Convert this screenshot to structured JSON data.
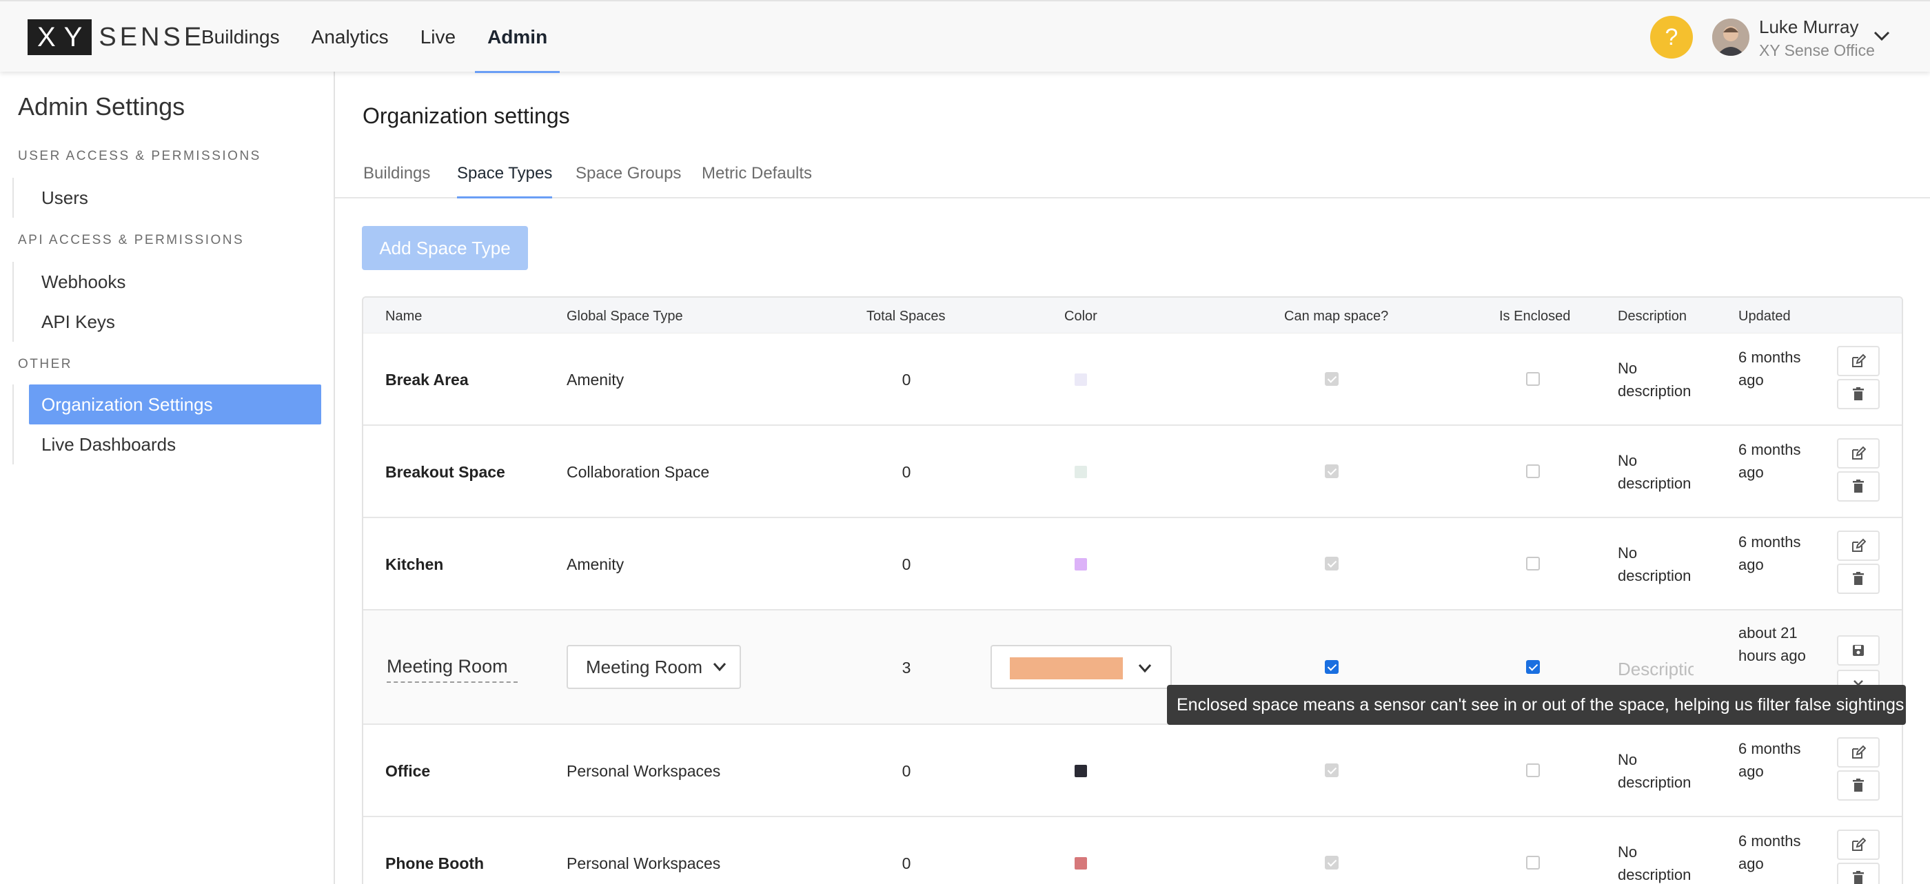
{
  "brand": {
    "logo_mark": "XY",
    "logo_word": "SENSE"
  },
  "nav": {
    "items": [
      {
        "label": "Buildings",
        "active": false
      },
      {
        "label": "Analytics",
        "active": false
      },
      {
        "label": "Live",
        "active": false
      },
      {
        "label": "Admin",
        "active": true
      }
    ]
  },
  "user": {
    "help_glyph": "?",
    "name": "Luke Murray",
    "org": "XY Sense Office"
  },
  "sidebar": {
    "title": "Admin Settings",
    "sections": [
      {
        "label": "USER ACCESS & PERMISSIONS",
        "items": [
          {
            "label": "Users"
          }
        ]
      },
      {
        "label": "API ACCESS & PERMISSIONS",
        "items": [
          {
            "label": "Webhooks"
          },
          {
            "label": "API Keys"
          }
        ]
      },
      {
        "label": "OTHER",
        "items": [
          {
            "label": "Organization Settings",
            "active": true
          },
          {
            "label": "Live Dashboards"
          }
        ]
      }
    ]
  },
  "main": {
    "title": "Organization settings",
    "tabs": [
      {
        "label": "Buildings"
      },
      {
        "label": "Space Types",
        "active": true
      },
      {
        "label": "Space Groups"
      },
      {
        "label": "Metric Defaults"
      }
    ],
    "add_button": "Add Space Type"
  },
  "table": {
    "headers": [
      "Name",
      "Global Space Type",
      "Total Spaces",
      "Color",
      "Can map space?",
      "Is Enclosed",
      "Description",
      "Updated"
    ],
    "rows": [
      {
        "name": "Break Area",
        "global": "Amenity",
        "total": "0",
        "color": "#ebe9f7",
        "desc": "No description",
        "updated": "6 months ago"
      },
      {
        "name": "Breakout Space",
        "global": "Collaboration Space",
        "total": "0",
        "color": "#e3ede8",
        "desc": "No description",
        "updated": "6 months ago"
      },
      {
        "name": "Kitchen",
        "global": "Amenity",
        "total": "0",
        "color": "#dcb2f8",
        "desc": "No description",
        "updated": "6 months ago"
      },
      {
        "name": "Meeting Room",
        "global": "Meeting Room",
        "total": "3",
        "color": "#f2b186",
        "desc_placeholder": "Description",
        "updated": "about 21 hours ago",
        "editing": true
      },
      {
        "name": "Office",
        "global": "Personal Workspaces",
        "total": "0",
        "color": "#2a2a34",
        "desc": "No description",
        "updated": "6 months ago"
      },
      {
        "name": "Phone Booth",
        "global": "Personal Workspaces",
        "total": "0",
        "color": "#d6787a",
        "desc": "No description",
        "updated": "6 months ago"
      }
    ]
  },
  "tooltip": {
    "text": "Enclosed space means a sensor can't see in or out of the space, helping us filter false sightings"
  },
  "colors": {
    "accent": "#6a9ef5",
    "checkbox_active": "#1a6fe0",
    "help": "#f5c02e"
  }
}
